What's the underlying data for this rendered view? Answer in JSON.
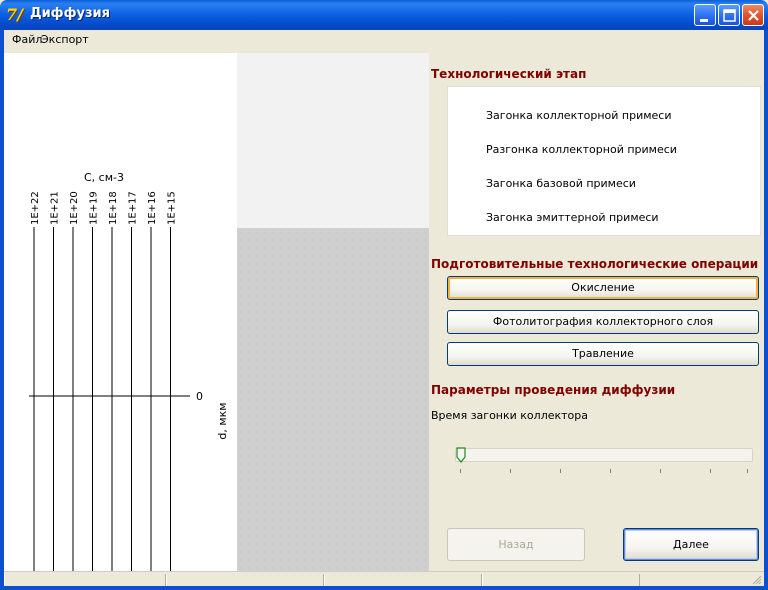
{
  "window": {
    "title": "Диффузия",
    "icon_glyph": "7/",
    "accent": "#0a5fd8"
  },
  "menu": {
    "items": [
      "Файл",
      "Экспорт"
    ]
  },
  "plot": {
    "concentration_label": "C, см-3",
    "depth_label": "d, мкм",
    "depth_zero": "0",
    "ticks": [
      "1E+22",
      "1E+21",
      "1E+20",
      "1E+19",
      "1E+18",
      "1E+17",
      "1E+16",
      "1E+15"
    ]
  },
  "right_panel": {
    "stage_title": "Технологический этап",
    "stages": [
      "Загонка коллекторной примеси",
      "Разгонка коллекторной примеси",
      "Загонка базовой примеси",
      "Загонка эмиттерной примеси"
    ],
    "prep_title": "Подготовительные технологические операции",
    "prep_buttons": [
      "Окисление",
      "Фотолитография коллекторного слоя",
      "Травление"
    ],
    "params_title": "Параметры проведения диффузии",
    "time_label": "Время загонки коллектора",
    "slider_value": 0,
    "back_label": "Назад",
    "next_label": "Далее"
  },
  "colors": {
    "section_title": "#800000",
    "title_bar": "#0a5fd8",
    "panel_bg": "#ece9d8"
  }
}
